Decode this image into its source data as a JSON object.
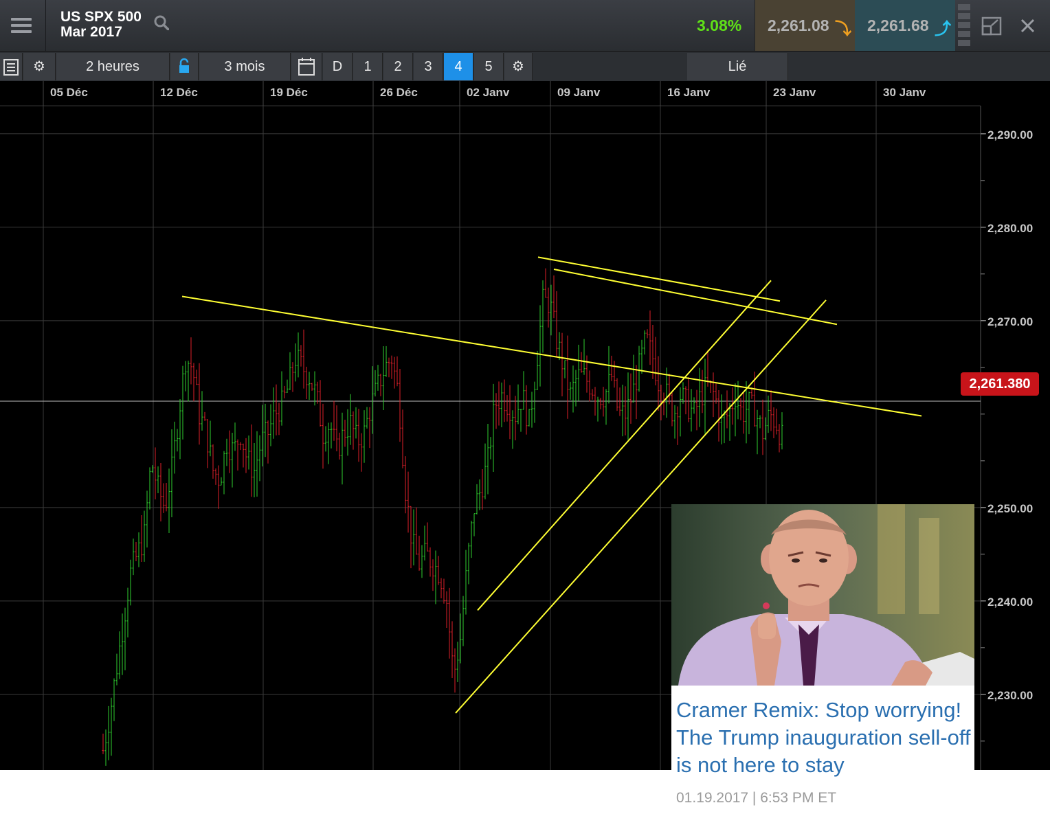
{
  "header": {
    "instrument_name": "US SPX 500",
    "instrument_expiry": "Mar 2017",
    "change_percent": "3.08%",
    "sell_price": "2,261.08",
    "buy_price": "2,261.68",
    "colors": {
      "change": "#5fe018",
      "sell_arrow": "#f0a020",
      "buy_arrow": "#29c4f0"
    }
  },
  "toolbar": {
    "interval": "2 heures",
    "range": "3 mois",
    "layout_d": "D",
    "layout_buttons": [
      "1",
      "2",
      "3",
      "4",
      "5"
    ],
    "active_layout": "4",
    "linked_label": "Lié"
  },
  "chart_data": {
    "type": "candlestick",
    "x_tick_labels": [
      "05 Déc",
      "12 Déc",
      "19 Déc",
      "26 Déc",
      "02 Janv",
      "09 Janv",
      "16 Janv",
      "23 Janv",
      "30 Janv"
    ],
    "y_tick_labels": [
      "2,290.00",
      "2,280.00",
      "2,270.00",
      "2,250.00",
      "2,240.00",
      "2,230.00"
    ],
    "y_ticks": [
      2290,
      2280,
      2270,
      2250,
      2240,
      2230
    ],
    "ylim": [
      2221.9,
      2293.0
    ],
    "current_price": 2261.38,
    "current_price_label": "2,261.380",
    "grid": true,
    "colors": {
      "up": "#2fd12f",
      "down": "#e0202a",
      "trendline": "#ffff33",
      "background": "#000000"
    },
    "trendlines": [
      {
        "from": [
          "12 Déc",
          2272.6
        ],
        "to": [
          "30 Janv",
          2259.8
        ]
      },
      {
        "from": [
          "09 Janv",
          2276.8
        ],
        "to": [
          "23 Janv",
          2272.1
        ]
      },
      {
        "from": [
          "09 Janv",
          2275.5
        ],
        "to": [
          "30 Janv",
          2269.6
        ]
      },
      {
        "from": [
          "02 Janv",
          2239.0
        ],
        "to": [
          "23 Janv",
          2274.3
        ]
      },
      {
        "from": [
          "02 Janv",
          2228.0
        ],
        "to": [
          "30 Janv",
          2272.2
        ]
      }
    ]
  },
  "news": {
    "headline": "Cramer Remix: Stop worrying! The Trump inauguration sell-off is not here to stay",
    "timestamp": "01.19.2017 | 6:53 PM ET"
  }
}
